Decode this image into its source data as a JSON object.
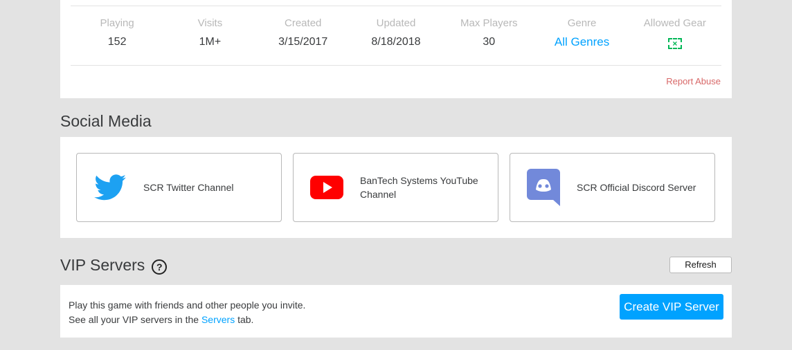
{
  "stats": [
    {
      "label": "Playing",
      "value": "152"
    },
    {
      "label": "Visits",
      "value": "1M+"
    },
    {
      "label": "Created",
      "value": "3/15/2017"
    },
    {
      "label": "Updated",
      "value": "8/18/2018"
    },
    {
      "label": "Max Players",
      "value": "30"
    },
    {
      "label": "Genre",
      "value": "All Genres"
    },
    {
      "label": "Allowed Gear",
      "value": ""
    }
  ],
  "report_abuse": "Report Abuse",
  "social": {
    "title": "Social Media",
    "links": [
      {
        "label": "SCR Twitter Channel",
        "icon": "twitter-icon",
        "color": "#1da1f2"
      },
      {
        "label": "BanTech Systems YouTube Channel",
        "icon": "youtube-icon",
        "color": "#ff0000"
      },
      {
        "label": "SCR Official Discord Server",
        "icon": "discord-icon",
        "color": "#7289da"
      }
    ]
  },
  "vip": {
    "title": "VIP Servers",
    "help_glyph": "?",
    "refresh_label": "Refresh",
    "line1": "Play this game with friends and other people you invite.",
    "line2_prefix": "See all your VIP servers in the ",
    "line2_link": "Servers",
    "line2_suffix": " tab.",
    "create_label": "Create VIP Server"
  },
  "colors": {
    "accent": "#00a2ff",
    "report": "#d86868",
    "gear": "#02b757"
  }
}
